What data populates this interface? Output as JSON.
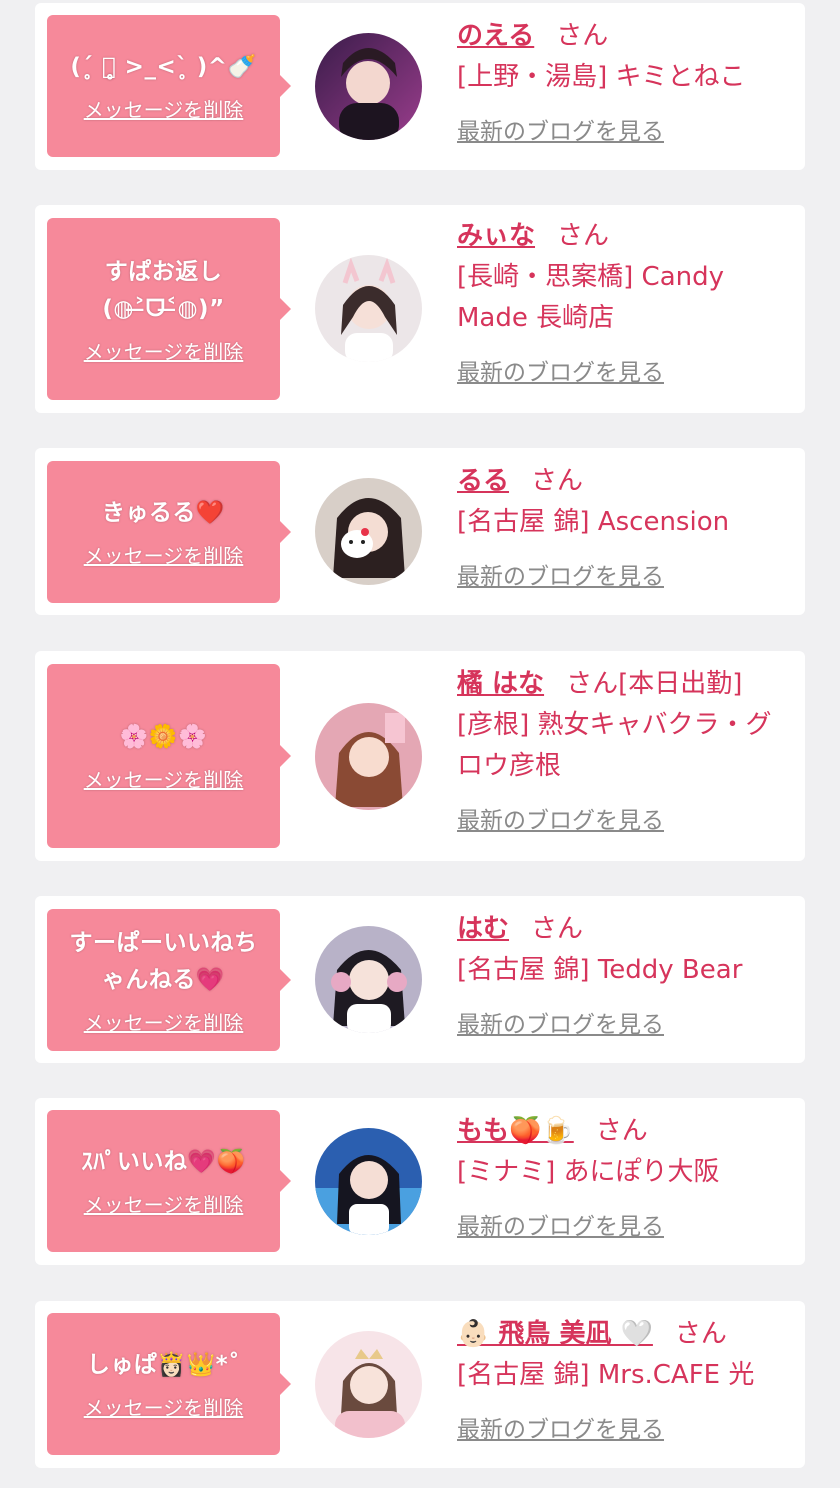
{
  "delete_label": "メッセージを削除",
  "san_label": "さん",
  "blog_label": "最新のブログを見る",
  "items": [
    {
      "message": "(ˊ̥ っ̥̥ >_<ˋ̥ )^🍼",
      "name": "のえる",
      "status": "",
      "shop": "[上野・湯島] キミとねこ"
    },
    {
      "message": "すぱお返し(◍˃̶ᗜ˂̶◍)”",
      "name": "みぃな",
      "status": "",
      "shop": "[長崎・思案橋] Candy Made 長崎店"
    },
    {
      "message": "きゅるる❤️",
      "name": "るる",
      "status": "",
      "shop": "[名古屋 錦] Ascension"
    },
    {
      "message": "🌸🌼🌸",
      "name": "橘 はな",
      "status": "[本日出勤]",
      "shop": "[彦根] 熟女キャバクラ・グロウ彦根"
    },
    {
      "message": "すーぱーいいねち\nゃんねる💗",
      "name": "はむ",
      "status": "",
      "shop": "[名古屋 錦] Teddy Bear"
    },
    {
      "message": "ｽﾊﾟいいね💗🍑",
      "name": "もも🍑🍺",
      "status": "",
      "shop": "[ミナミ] あにぽり大阪"
    },
    {
      "message": "しゅぱ👸🏻👑*˚",
      "name": "👶🏻 飛鳥 美凪 🤍",
      "status": "",
      "shop": "[名古屋 錦] Mrs.CAFE 光"
    }
  ],
  "colors": {
    "bubble": "#f6899a",
    "accent": "#d6345b",
    "link_gray": "#8a8a8a",
    "page_bg": "#f0f0f2"
  }
}
